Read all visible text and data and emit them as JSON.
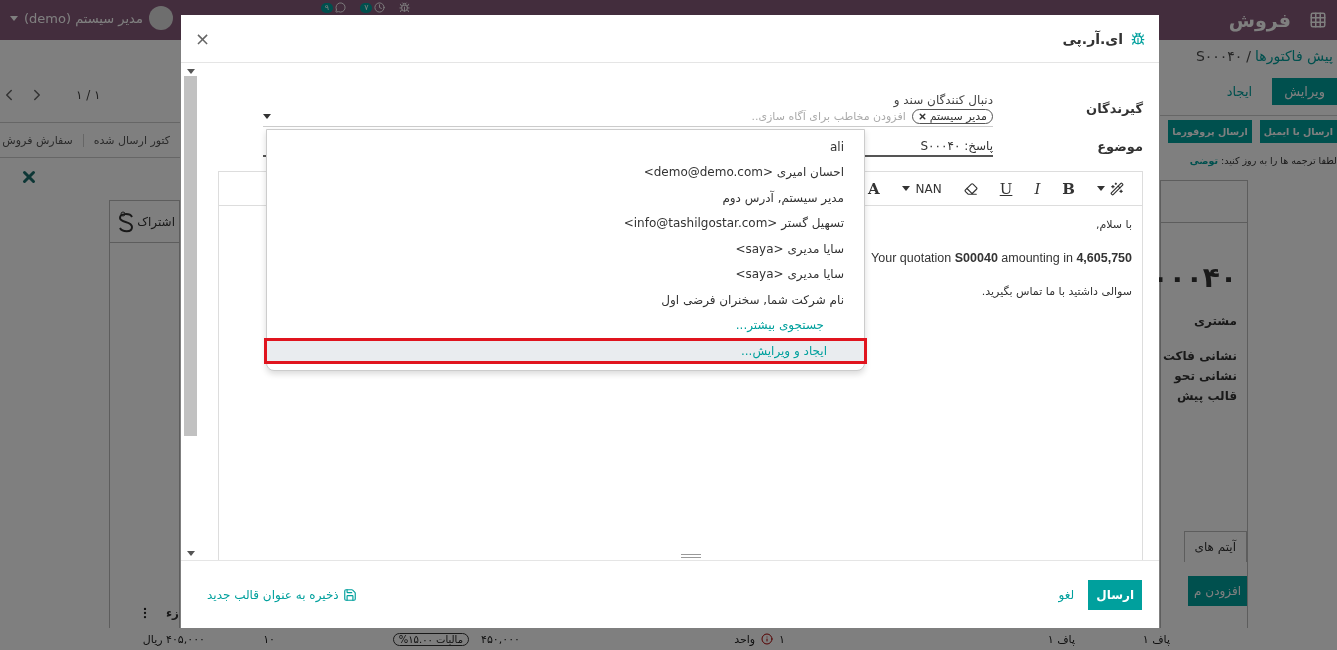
{
  "top_bar": {
    "app_title": "فروش",
    "user": "مدیر سیستم (demo)",
    "messages_count": "۹",
    "activities_count": "۷"
  },
  "page": {
    "breadcrumb": {
      "parent": "پیش فاکتورها",
      "separator": "/",
      "current": "S۰۰۰۴۰"
    },
    "buttons": [
      {
        "label": "ویرایش",
        "kind": "primary"
      },
      {
        "label": "ایجاد",
        "kind": "link"
      }
    ],
    "pager": "۱ / ۱",
    "actions": [
      "ارسال با ایمیل",
      "ارسال پروفورما"
    ],
    "statusbar": [
      "کتور ارسال شده",
      "سفارش فروش"
    ],
    "notice": {
      "text": "لطفا ترجمه ها را به روز کنید:",
      "link": "توضی"
    },
    "smart_button": "اشتراک",
    "sheet": {
      "title": "۰۰۰۴۰",
      "fields": [
        "مشتری",
        "نشانی فاکت",
        "نشانی تحو",
        "قالب پیش"
      ]
    },
    "tab": "آیتم های",
    "add_line": "افزودن م",
    "column_header": "زء",
    "line": {
      "product": "پاف ۱",
      "description": "پاف ۱",
      "quantity": "۱",
      "uom": "واحد",
      "price": "۴۵۰,۰۰۰",
      "tax": "مالیات ۱۵.۰۰%",
      "discount": "۱۰",
      "subtotal": "۴۰۵,۰۰۰ ریال"
    }
  },
  "dialog": {
    "title": "ای.آر.پی",
    "close": "×",
    "recipients": {
      "label": "گیرندگان",
      "followers_note": "دنبال کنندگان سند و",
      "tags": [
        "مدیر سیستم"
      ],
      "placeholder": "افزودن مخاطب برای آگاه سازی.."
    },
    "subject": {
      "label": "موضوع",
      "value": "پاسخ: S۰۰۰۴۰"
    },
    "toolbar": [
      {
        "kind": "style"
      },
      {
        "kind": "bold",
        "label": "B"
      },
      {
        "kind": "italic",
        "label": "I"
      },
      {
        "kind": "underline",
        "label": "U"
      },
      {
        "kind": "eraser"
      },
      {
        "kind": "size",
        "label": "NAN"
      },
      {
        "kind": "color",
        "label": "A"
      }
    ],
    "body": {
      "greeting": "با سلام,",
      "line": "Your quotation **S00040** amounting in **4,605,750**",
      "closing": "سوالی داشتید با ما تماس بگیرید."
    },
    "dropdown": [
      {
        "label": "ali",
        "kind": "contact",
        "selected": false
      },
      {
        "label": "احسان امیری <demo@demo.com>",
        "kind": "contact",
        "selected": false
      },
      {
        "label": "مدیر سیستم, آدرس دوم",
        "kind": "contact",
        "selected": false
      },
      {
        "label": "تسهیل گستر <info@tashilgostar.com>",
        "kind": "contact",
        "selected": false
      },
      {
        "label": "سایا مدیری <saya>",
        "kind": "contact",
        "selected": false
      },
      {
        "label": "سایا مدیری <saya>",
        "kind": "contact",
        "selected": false
      },
      {
        "label": "نام شرکت شما, سخنران فرضی اول",
        "kind": "contact",
        "selected": false
      },
      {
        "label": "جستجوی بیشتر...",
        "kind": "action",
        "selected": false
      },
      {
        "label": "ایجاد و ویرایش...",
        "kind": "action",
        "selected": true
      }
    ],
    "footer": {
      "send": "ارسال",
      "cancel": "لغو",
      "save_template": "ذخیره به عنوان قالب جدید"
    }
  }
}
